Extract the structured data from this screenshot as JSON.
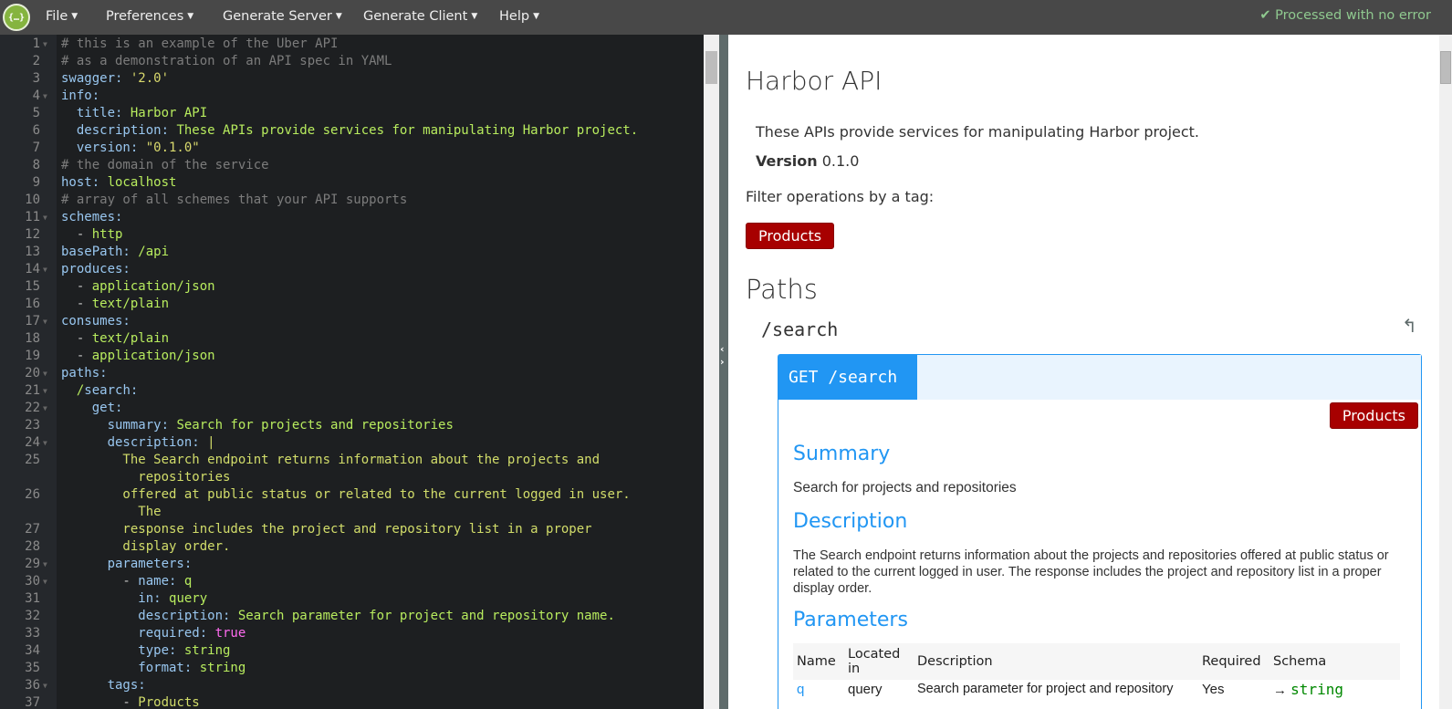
{
  "topbar": {
    "logo_text": "{…}",
    "menus": [
      "File",
      "Preferences",
      "Generate Server",
      "Generate Client",
      "Help"
    ],
    "status": "Processed with no error",
    "status_icon": "check-icon"
  },
  "editor": {
    "lines": [
      {
        "n": "1",
        "f": true,
        "s": [
          [
            "c",
            "# this is an example of the Uber API"
          ]
        ]
      },
      {
        "n": "2",
        "s": [
          [
            "c",
            "# as a demonstration of an API spec in YAML"
          ]
        ]
      },
      {
        "n": "3",
        "s": [
          [
            "k",
            "swagger: "
          ],
          [
            "q",
            "'2.0'"
          ]
        ]
      },
      {
        "n": "4",
        "f": true,
        "s": [
          [
            "k",
            "info:"
          ]
        ]
      },
      {
        "n": "5",
        "s": [
          [
            "k",
            "  title: "
          ],
          [
            "v",
            "Harbor API"
          ]
        ]
      },
      {
        "n": "6",
        "s": [
          [
            "k",
            "  description: "
          ],
          [
            "v",
            "These APIs provide services for manipulating Harbor project."
          ]
        ]
      },
      {
        "n": "7",
        "s": [
          [
            "k",
            "  version: "
          ],
          [
            "q",
            "\"0.1.0\""
          ]
        ]
      },
      {
        "n": "8",
        "s": [
          [
            "c",
            "# the domain of the service"
          ]
        ]
      },
      {
        "n": "9",
        "s": [
          [
            "k",
            "host: "
          ],
          [
            "v",
            "localhost"
          ]
        ]
      },
      {
        "n": "10",
        "s": [
          [
            "c",
            "# array of all schemes that your API supports"
          ]
        ]
      },
      {
        "n": "11",
        "f": true,
        "s": [
          [
            "k",
            "schemes:"
          ]
        ]
      },
      {
        "n": "12",
        "s": [
          [
            "p",
            "  - "
          ],
          [
            "v",
            "http"
          ]
        ]
      },
      {
        "n": "13",
        "s": [
          [
            "k",
            "basePath: "
          ],
          [
            "v",
            "/api"
          ]
        ]
      },
      {
        "n": "14",
        "f": true,
        "s": [
          [
            "k",
            "produces:"
          ]
        ]
      },
      {
        "n": "15",
        "s": [
          [
            "p",
            "  - "
          ],
          [
            "v",
            "application/json"
          ]
        ]
      },
      {
        "n": "16",
        "s": [
          [
            "p",
            "  - "
          ],
          [
            "v",
            "text/plain"
          ]
        ]
      },
      {
        "n": "17",
        "f": true,
        "s": [
          [
            "k",
            "consumes:"
          ]
        ]
      },
      {
        "n": "18",
        "s": [
          [
            "p",
            "  - "
          ],
          [
            "v",
            "text/plain"
          ]
        ]
      },
      {
        "n": "19",
        "s": [
          [
            "p",
            "  - "
          ],
          [
            "v",
            "application/json"
          ]
        ]
      },
      {
        "n": "20",
        "f": true,
        "s": [
          [
            "k",
            "paths:"
          ]
        ]
      },
      {
        "n": "21",
        "f": true,
        "s": [
          [
            "v",
            "  /"
          ],
          [
            "k",
            "search:"
          ]
        ]
      },
      {
        "n": "22",
        "f": true,
        "s": [
          [
            "k",
            "    get:"
          ]
        ]
      },
      {
        "n": "23",
        "s": [
          [
            "k",
            "      summary: "
          ],
          [
            "v",
            "Search for projects and repositories"
          ]
        ]
      },
      {
        "n": "24",
        "f": true,
        "s": [
          [
            "k",
            "      description: "
          ],
          [
            "y",
            "|"
          ]
        ]
      },
      {
        "n": "25",
        "s": [
          [
            "y",
            "        The Search endpoint returns information about the projects and"
          ]
        ]
      },
      {
        "n": "",
        "s": [
          [
            "y",
            "          repositories"
          ]
        ]
      },
      {
        "n": "26",
        "s": [
          [
            "y",
            "        offered at public status or related to the current logged in user."
          ]
        ]
      },
      {
        "n": "",
        "s": [
          [
            "y",
            "          The"
          ]
        ]
      },
      {
        "n": "27",
        "s": [
          [
            "y",
            "        response includes the project and repository list in a proper"
          ]
        ]
      },
      {
        "n": "28",
        "s": [
          [
            "y",
            "        display order."
          ]
        ]
      },
      {
        "n": "29",
        "f": true,
        "s": [
          [
            "k",
            "      parameters:"
          ]
        ]
      },
      {
        "n": "30",
        "f": true,
        "s": [
          [
            "p",
            "        - "
          ],
          [
            "k",
            "name: "
          ],
          [
            "v",
            "q"
          ]
        ]
      },
      {
        "n": "31",
        "s": [
          [
            "k",
            "          in: "
          ],
          [
            "v",
            "query"
          ]
        ]
      },
      {
        "n": "32",
        "s": [
          [
            "k",
            "          description: "
          ],
          [
            "v",
            "Search parameter for project and repository name."
          ]
        ]
      },
      {
        "n": "33",
        "s": [
          [
            "k",
            "          required: "
          ],
          [
            "b",
            "true"
          ]
        ]
      },
      {
        "n": "34",
        "s": [
          [
            "k",
            "          type: "
          ],
          [
            "v",
            "string"
          ]
        ]
      },
      {
        "n": "35",
        "s": [
          [
            "k",
            "          format: "
          ],
          [
            "v",
            "string"
          ]
        ]
      },
      {
        "n": "36",
        "f": true,
        "s": [
          [
            "k",
            "      tags:"
          ]
        ]
      },
      {
        "n": "37",
        "s": [
          [
            "p",
            "        - "
          ],
          [
            "y",
            "Products"
          ]
        ]
      }
    ]
  },
  "preview": {
    "title": "Harbor API",
    "description": "These APIs provide services for manipulating Harbor project.",
    "version_label": "Version",
    "version": "0.1.0",
    "filter_label": "Filter operations by a tag:",
    "tag": "Products",
    "paths_heading": "Paths",
    "path": "/search",
    "operation": {
      "method_path": "GET /search",
      "tag": "Products",
      "summary_heading": "Summary",
      "summary": "Search for projects and repositories",
      "description_heading": "Description",
      "description": "The Search endpoint returns information about the projects and repositories offered at public status or related to the current logged in user. The response includes the project and repository list in a proper display order.",
      "parameters_heading": "Parameters",
      "columns": [
        "Name",
        "Located in",
        "Description",
        "Required",
        "Schema"
      ],
      "rows": [
        {
          "name": "q",
          "in": "query",
          "description": "Search parameter for project and repository",
          "required": "Yes",
          "schema": "string"
        }
      ]
    }
  },
  "colors": {
    "accent": "#2196f3",
    "tag": "#a70000",
    "topbar": "#484848",
    "editor_bg": "#1d1f21",
    "status": "#8fc98f"
  }
}
